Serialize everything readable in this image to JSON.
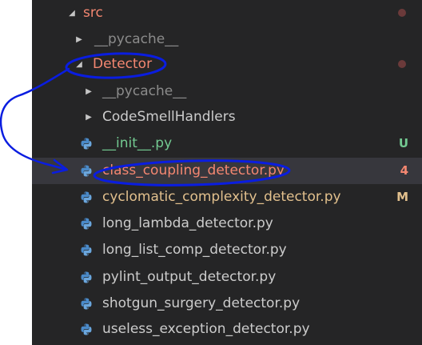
{
  "tree": {
    "src": {
      "label": "src"
    },
    "src_pycache": {
      "label": "__pycache__"
    },
    "detector": {
      "label": "Detector"
    },
    "detector_pycache": {
      "label": "__pycache__"
    },
    "codesmellhandlers": {
      "label": "CodeSmellHandlers"
    },
    "files": [
      {
        "label": "__init__.py",
        "badge": "U"
      },
      {
        "label": "class_coupling_detector.py",
        "badge": "4"
      },
      {
        "label": "cyclomatic_complexity_detector.py",
        "badge": "M"
      },
      {
        "label": "long_lambda_detector.py"
      },
      {
        "label": "long_list_comp_detector.py"
      },
      {
        "label": "pylint_output_detector.py"
      },
      {
        "label": "shotgun_surgery_detector.py"
      },
      {
        "label": "useless_exception_detector.py"
      }
    ]
  },
  "icons": {
    "folder_expanded": "triangle-down-icon",
    "folder_collapsed": "triangle-right-icon",
    "file": "python-icon",
    "status": "dot-icon"
  },
  "colors": {
    "background": "#252526",
    "selection": "#37373d",
    "error": "#f48771",
    "modified": "#e2c08d",
    "untracked": "#73c991",
    "annotation": "#0a1de0"
  }
}
